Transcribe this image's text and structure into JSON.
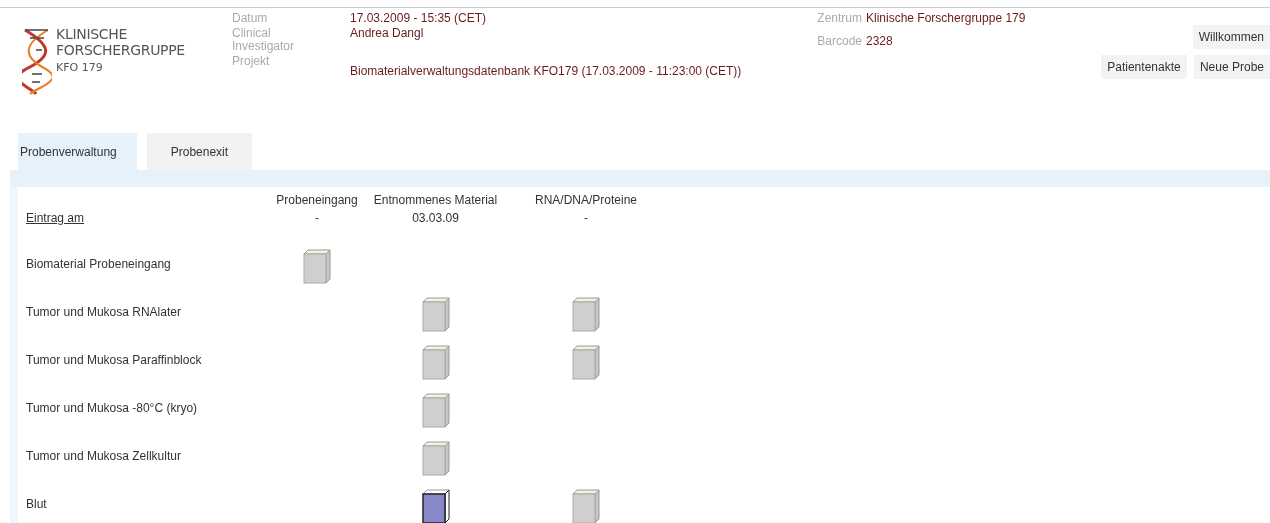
{
  "logo": {
    "line_1": "KLINISCHE",
    "line_2": "FORSCHERGRUPPE",
    "line_3": "KFO 179"
  },
  "info": [
    {
      "label": "Datum",
      "value": "17.03.2009 - 15:35 (CET)"
    },
    {
      "label": "Clinical Investigator",
      "value": "Andrea Dangl"
    },
    {
      "label": "Projekt",
      "value": "Biomaterialverwaltungsdatenbank KFO179 (17.03.2009 - 11:23:00 (CET))"
    }
  ],
  "meta": [
    {
      "label": "Zentrum",
      "value": "Klinische Forschergruppe 179"
    },
    {
      "label": "Barcode",
      "value": "2328"
    }
  ],
  "buttons": [
    {
      "label": "Willkommen"
    },
    {
      "label": "Patientenakte"
    },
    {
      "label": "Neue Probe"
    }
  ],
  "tabs": [
    {
      "label": "Probenverwaltung",
      "selected": true
    },
    {
      "label": "Probenexit",
      "selected": false
    }
  ],
  "table": {
    "columns": [
      "Probeneingang",
      "Entnommenes Material",
      "RNA/DNA/Proteine"
    ],
    "entry": {
      "label": "Eintrag am",
      "values": [
        "-",
        "03.03.09",
        "-"
      ]
    },
    "rows": [
      {
        "label": "Biomaterial Probeneingang",
        "cells": [
          {
            "kind": "box",
            "selected": false
          },
          {
            "kind": "none"
          },
          {
            "kind": "none"
          }
        ]
      },
      {
        "label": "Tumor und Mukosa RNAlater",
        "cells": [
          {
            "kind": "none"
          },
          {
            "kind": "box",
            "selected": false
          },
          {
            "kind": "box",
            "selected": false
          }
        ]
      },
      {
        "label": "Tumor und Mukosa Paraffinblock",
        "cells": [
          {
            "kind": "none"
          },
          {
            "kind": "box",
            "selected": false
          },
          {
            "kind": "box",
            "selected": false
          }
        ]
      },
      {
        "label": "Tumor und Mukosa -80°C (kryo)",
        "cells": [
          {
            "kind": "none"
          },
          {
            "kind": "box",
            "selected": false
          },
          {
            "kind": "none"
          }
        ]
      },
      {
        "label": "Tumor und Mukosa Zellkultur",
        "cells": [
          {
            "kind": "none"
          },
          {
            "kind": "box",
            "selected": false
          },
          {
            "kind": "none"
          }
        ]
      },
      {
        "label": "Blut",
        "cells": [
          {
            "kind": "none"
          },
          {
            "kind": "box",
            "selected": true
          },
          {
            "kind": "box",
            "selected": false
          }
        ]
      }
    ]
  }
}
